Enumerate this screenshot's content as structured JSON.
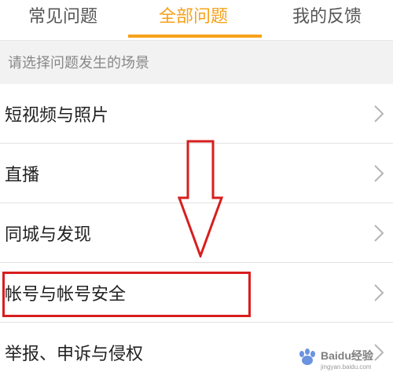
{
  "tabs": [
    {
      "label": "常见问题"
    },
    {
      "label": "全部问题"
    },
    {
      "label": "我的反馈"
    }
  ],
  "section_header": "请选择问题发生的场景",
  "items": [
    {
      "label": "短视频与照片"
    },
    {
      "label": "直播"
    },
    {
      "label": "同城与发现"
    },
    {
      "label": "帐号与帐号安全"
    },
    {
      "label": "举报、申诉与侵权"
    }
  ],
  "watermark": {
    "text": "Baidu经验",
    "sub": "jingyan.baidu.com"
  },
  "colors": {
    "accent": "#f7a11a",
    "annotation": "#d81e1e"
  },
  "icons": {
    "chevron": "chevron-right-icon",
    "arrow": "down-arrow-icon"
  }
}
